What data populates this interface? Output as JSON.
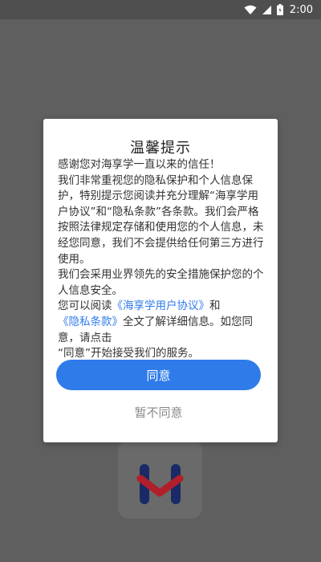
{
  "status_bar": {
    "time": "2:00",
    "icons": [
      "wifi-icon",
      "signal-icon",
      "battery-icon"
    ]
  },
  "dialog": {
    "title": "温馨提示",
    "paragraphs": {
      "p1": "感谢您对海享学一直以来的信任！",
      "p2": "我们非常重视您的隐私保护和个人信息保护，特别提示您阅读并充分理解“海享学用户协议”和“隐私条款”各条款。我们会严格按照法律规定存储和使用您的个人信息，未经您同意，我们不会提供给任何第三方进行使用。",
      "p3": "我们会采用业界领先的安全措施保护您的个人信息安全。",
      "p4_prefix": "您可以阅读",
      "p4_link1": "《海享学用户协议》",
      "p4_and": "和",
      "p4_link2": "《隐私条款》",
      "p4_suffix": "全文了解详细信息。如您同意，请点击",
      "p5": "“同意”开始接受我们的服务。"
    },
    "agree_label": "同意",
    "disagree_label": "暂不同意"
  },
  "colors": {
    "accent": "#2f7bea",
    "overlay": "#5f5f5f"
  }
}
